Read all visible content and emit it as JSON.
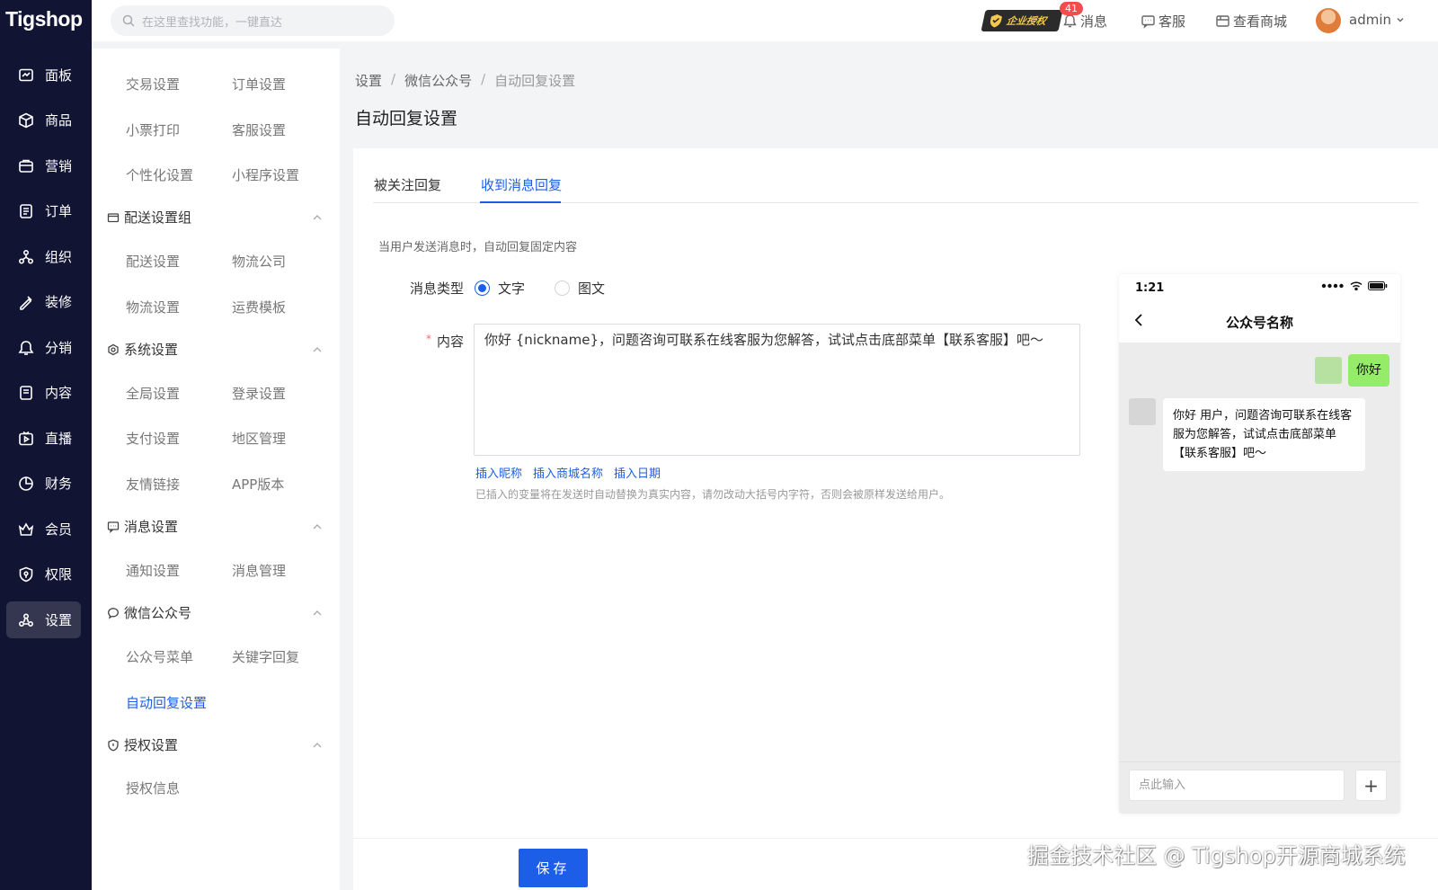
{
  "app": {
    "logo": "Tigshop"
  },
  "topbar": {
    "search_placeholder": "在这里查找功能，一键直达",
    "auth_badge": "企业授权",
    "message_count": "41",
    "message_label": "消息",
    "service_label": "客服",
    "store_label": "查看商城",
    "user": "admin"
  },
  "rail": {
    "items": [
      {
        "label": "面板",
        "icon": "dashboard-icon"
      },
      {
        "label": "商品",
        "icon": "box-icon"
      },
      {
        "label": "营销",
        "icon": "marketing-icon"
      },
      {
        "label": "订单",
        "icon": "order-icon"
      },
      {
        "label": "组织",
        "icon": "org-icon"
      },
      {
        "label": "装修",
        "icon": "decorate-icon"
      },
      {
        "label": "分销",
        "icon": "distribution-icon"
      },
      {
        "label": "内容",
        "icon": "content-icon"
      },
      {
        "label": "直播",
        "icon": "live-icon"
      },
      {
        "label": "财务",
        "icon": "finance-icon"
      },
      {
        "label": "会员",
        "icon": "member-icon"
      },
      {
        "label": "权限",
        "icon": "permission-icon"
      },
      {
        "label": "设置",
        "icon": "settings-icon"
      }
    ],
    "active": "设置"
  },
  "setnav": {
    "top_items": [
      "交易设置",
      "订单设置",
      "小票打印",
      "客服设置",
      "个性化设置",
      "小程序设置"
    ],
    "groups": [
      {
        "title": "配送设置组",
        "items": [
          "配送设置",
          "物流公司",
          "物流设置",
          "运费模板"
        ]
      },
      {
        "title": "系统设置",
        "items": [
          "全局设置",
          "登录设置",
          "支付设置",
          "地区管理",
          "友情链接",
          "APP版本"
        ]
      },
      {
        "title": "消息设置",
        "items": [
          "通知设置",
          "消息管理"
        ]
      },
      {
        "title": "微信公众号",
        "items": [
          "公众号菜单",
          "关键字回复",
          "自动回复设置"
        ]
      },
      {
        "title": "授权设置",
        "items": [
          "授权信息"
        ]
      }
    ]
  },
  "breadcrumb": [
    "设置",
    "微信公众号",
    "自动回复设置"
  ],
  "page_title": "自动回复设置",
  "tabs": [
    "被关注回复",
    "收到消息回复"
  ],
  "form": {
    "description": "当用户发送消息时，自动回复固定内容",
    "type_label": "消息类型",
    "type_options": [
      "文字",
      "图文"
    ],
    "type_selected": "文字",
    "required_mark": "*",
    "content_label": "内容",
    "content_value": "你好 {nickname}，问题咨询可联系在线客服为您解答，试试点击底部菜单【联系客服】吧～",
    "insert_links": [
      "插入昵称",
      "插入商城名称",
      "插入日期"
    ],
    "tip": "已插入的变量将在发送时自动替换为真实内容，请勿改动大括号内字符，否则会被原样发送给用户。",
    "save": "保存"
  },
  "preview": {
    "time": "1:21",
    "title": "公众号名称",
    "user_msg": "你好",
    "reply_msg": "你好 用户，问题咨询可联系在线客服为您解答，试试点击底部菜单【联系客服】吧～",
    "input_placeholder": "点此输入",
    "plus": "+"
  },
  "watermark": "掘金技术社区 @ Tigshop开源商城系统",
  "colors": {
    "accent": "#1d5ee8",
    "rail_bg": "#121433",
    "bubble_green": "#95ec69"
  }
}
